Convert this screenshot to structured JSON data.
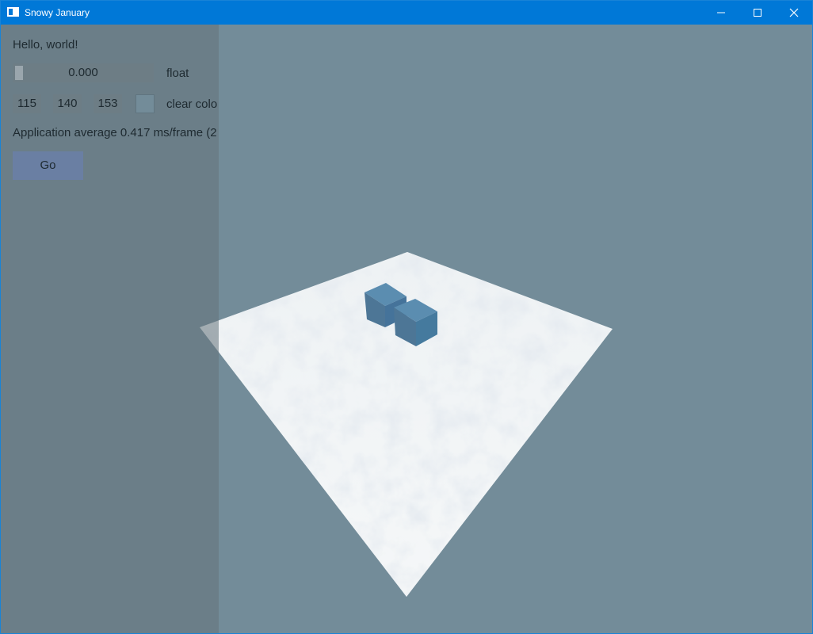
{
  "window": {
    "title": "Snowy January",
    "controls": [
      "minimize",
      "maximize",
      "close"
    ]
  },
  "panel": {
    "greeting": "Hello, world!",
    "slider": {
      "value": "0.000",
      "label": "float",
      "fraction": 0.0
    },
    "clear_color": {
      "r": "115",
      "g": "140",
      "b": "153",
      "label": "clear colo",
      "swatch": "#738c99"
    },
    "stats": "Application average 0.417 ms/frame (2",
    "go_label": "Go"
  },
  "colors": {
    "background": "#738c99",
    "title_bar": "#0078d7",
    "snow": "#f2f6f8",
    "cube": "#4a7a9a"
  }
}
